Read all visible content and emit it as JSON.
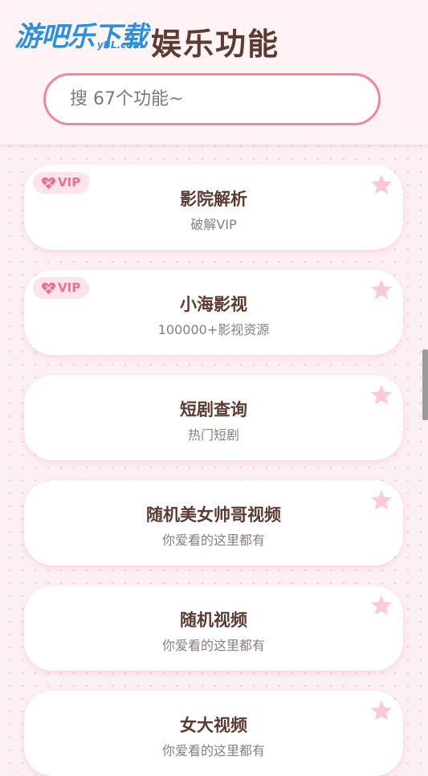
{
  "watermark": {
    "main": "游吧乐下载",
    "sub": "yBL.com"
  },
  "header": {
    "title": "娱乐功能"
  },
  "search": {
    "placeholder": "搜 67个功能~"
  },
  "colors": {
    "accent": "#f0869f",
    "title_text": "#5d3b32",
    "vip_text": "#f26f92",
    "star": "#fbcad6"
  },
  "cards": [
    {
      "title": "影院解析",
      "subtitle": "破解VIP",
      "vip": true,
      "vip_label": "VIP",
      "icon": "star-icon"
    },
    {
      "title": "小海影视",
      "subtitle": "100000+影视资源",
      "vip": true,
      "vip_label": "VIP",
      "icon": "star-icon"
    },
    {
      "title": "短剧查询",
      "subtitle": "热门短剧",
      "vip": false,
      "icon": "star-icon"
    },
    {
      "title": "随机美女帅哥视频",
      "subtitle": "你爱看的这里都有",
      "vip": false,
      "icon": "star-icon"
    },
    {
      "title": "随机视频",
      "subtitle": "你爱看的这里都有",
      "vip": false,
      "icon": "star-icon"
    },
    {
      "title": "女大视频",
      "subtitle": "你爱看的这里都有",
      "vip": false,
      "icon": "star-icon"
    }
  ]
}
